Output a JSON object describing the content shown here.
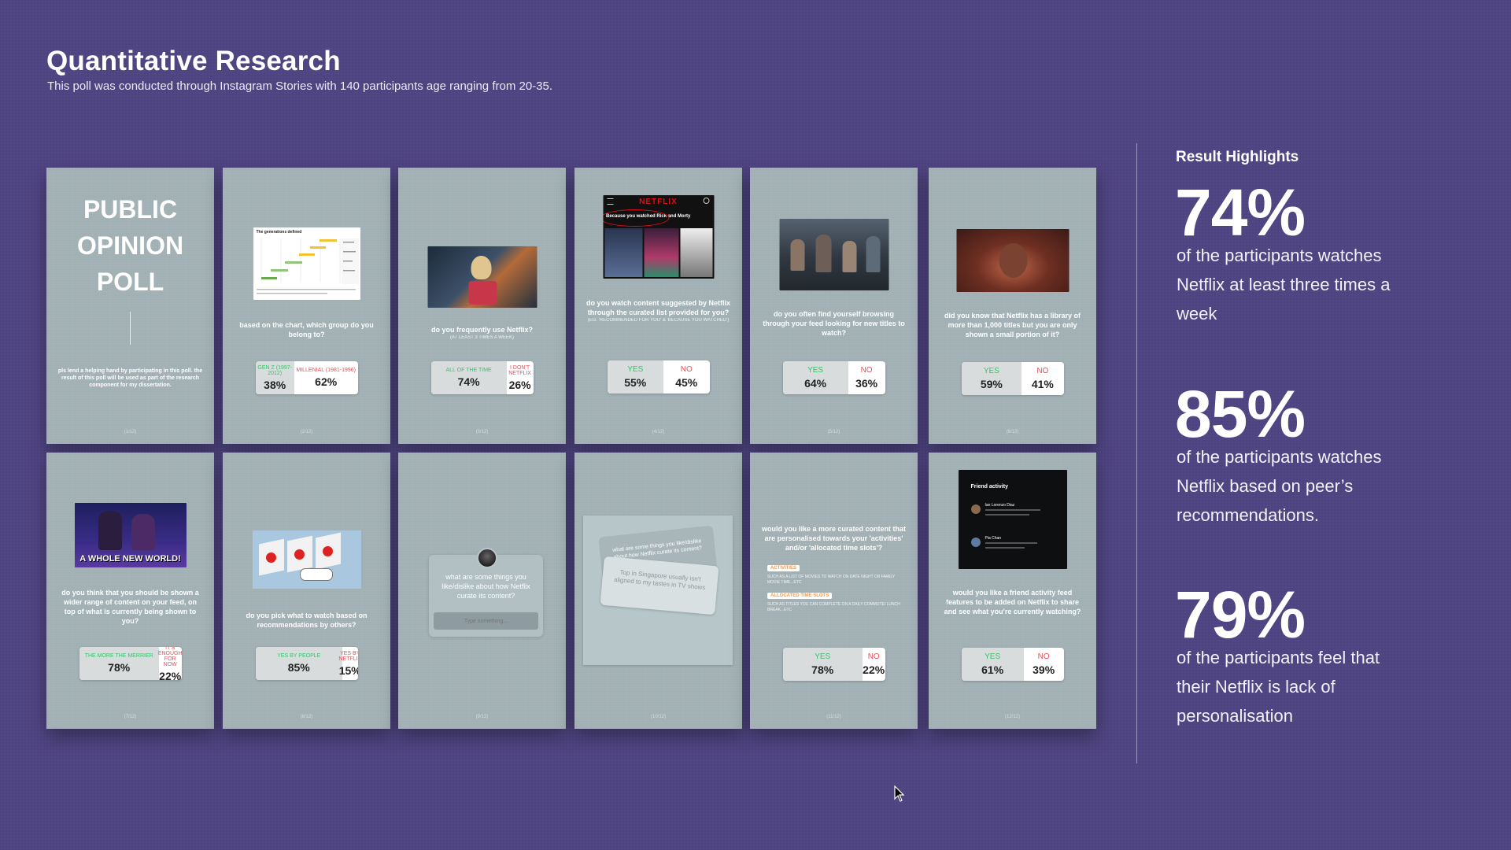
{
  "header": {
    "title": "Quantitative Research",
    "subtitle": "This poll was conducted through Instagram Stories with 140 participants age ranging from 20-35."
  },
  "cards": {
    "c1": {
      "heading": [
        "PUBLIC",
        "OPINION",
        "POLL"
      ],
      "text": "pls lend a helping hand by participating in this poll. the result of this poll will be used as part of the research component for my dissertation.",
      "pager": "(1/12)"
    },
    "c2": {
      "chart_title": "The generations defined",
      "question": "based on the chart, which group do you belong to?",
      "left_label": "GEN Z (1997-2012)",
      "left_pct": "38%",
      "right_label": "MILLENIAL (1981-1996)",
      "right_pct": "62%",
      "pager": "(2/12)"
    },
    "c3": {
      "question": "do you frequently use Netflix?",
      "sub": "(AT LEAST 3 TIMES A WEEK)",
      "left_label": "ALL OF THE TIME",
      "left_pct": "74%",
      "right_label": "I DON'T NETFLIX",
      "right_pct": "26%",
      "pager": "(3/12)"
    },
    "c4": {
      "brand": "NETFLIX",
      "row_label": "Because you watched Rick and Morty",
      "question": "do you watch content suggested by Netflix through the curated list provided for you?",
      "sub": "(EG. 'RECOMMENDED FOR YOU' & 'BECAUSE YOU WATCHED')",
      "left_label": "YES",
      "left_pct": "55%",
      "right_label": "NO",
      "right_pct": "45%",
      "pager": "(4/12)"
    },
    "c5": {
      "question": "do you often find yourself browsing through your feed looking for new titles to watch?",
      "left_label": "YES",
      "left_pct": "64%",
      "right_label": "NO",
      "right_pct": "36%",
      "pager": "(5/12)"
    },
    "c6": {
      "question": "did you know that Netflix has a library of more than 1,000 titles but you are only shown a small portion of it?",
      "left_label": "YES",
      "left_pct": "59%",
      "right_label": "NO",
      "right_pct": "41%",
      "pager": "(6/12)"
    },
    "c7": {
      "gif_caption": "A WHOLE NEW WORLD!",
      "question": "do you think that you should be shown a wider range of content on your feed, on top of what is currently being shown to you?",
      "left_label": "THE MORE THE MERRIER",
      "left_pct": "78%",
      "right_label": "IT'S ENOUGH FOR NOW",
      "right_pct": "22%",
      "pager": "(7/12)"
    },
    "c8": {
      "question": "do you pick what to watch based on recommendations by others?",
      "left_label": "YES BY PEOPLE",
      "left_pct": "85%",
      "right_label": "YES BY NETFLIX",
      "right_pct": "15%",
      "pager": "(8/12)"
    },
    "c9": {
      "question": "what are some things you like/dislike about how Netflix curate its content?",
      "input_placeholder": "Type something...",
      "pager": "(9/12)"
    },
    "c10": {
      "back_text": "what are some things you like/dislike about how Netflix curate its content?",
      "front_text": "Top in Singapore usually isn't aligned to my tastes in TV shows",
      "pager": "(10/12)"
    },
    "c11": {
      "question": "would you like a more curated content that are personalised towards your 'activities' and/or 'allocated time slots'?",
      "tag1": "ACTIVITIES",
      "tag1_text": "SUCH AS A LIST OF MOVIES TO WATCH ON DATE NIGHT OR FAMILY MOVIE TIME...ETC",
      "tag2": "ALLOCATED TIME SLOTS",
      "tag2_text": "SUCH AS TITLES YOU CAN COMPLETE ON A DAILY COMMUTE/ LUNCH BREAK...ETC",
      "left_label": "YES",
      "left_pct": "78%",
      "right_label": "NO",
      "right_pct": "22%",
      "pager": "(11/12)"
    },
    "c12": {
      "panel_title": "Friend activity",
      "friend1": "Ian Lorenzo Diaz",
      "friend2": "Pia Chan",
      "question": "would you like a friend activity feed features to be added on Netflix to share and see what you're currently watching?",
      "left_label": "YES",
      "left_pct": "61%",
      "right_label": "NO",
      "right_pct": "39%",
      "pager": "(12/12)"
    }
  },
  "highlights": {
    "title": "Result Highlights",
    "items": [
      {
        "value": "74%",
        "text": "of the participants watches Netflix at least three times a week"
      },
      {
        "value": "85%",
        "text": "of the participants watches Netflix based on peer’s recommendations."
      },
      {
        "value": "79%",
        "text": "of the participants feel that their Netflix is lack of personalisation"
      }
    ]
  },
  "colors": {
    "background": "#4f4482",
    "card": "#a1b0b4",
    "yes": "#35c46b",
    "no": "#e4525a"
  }
}
